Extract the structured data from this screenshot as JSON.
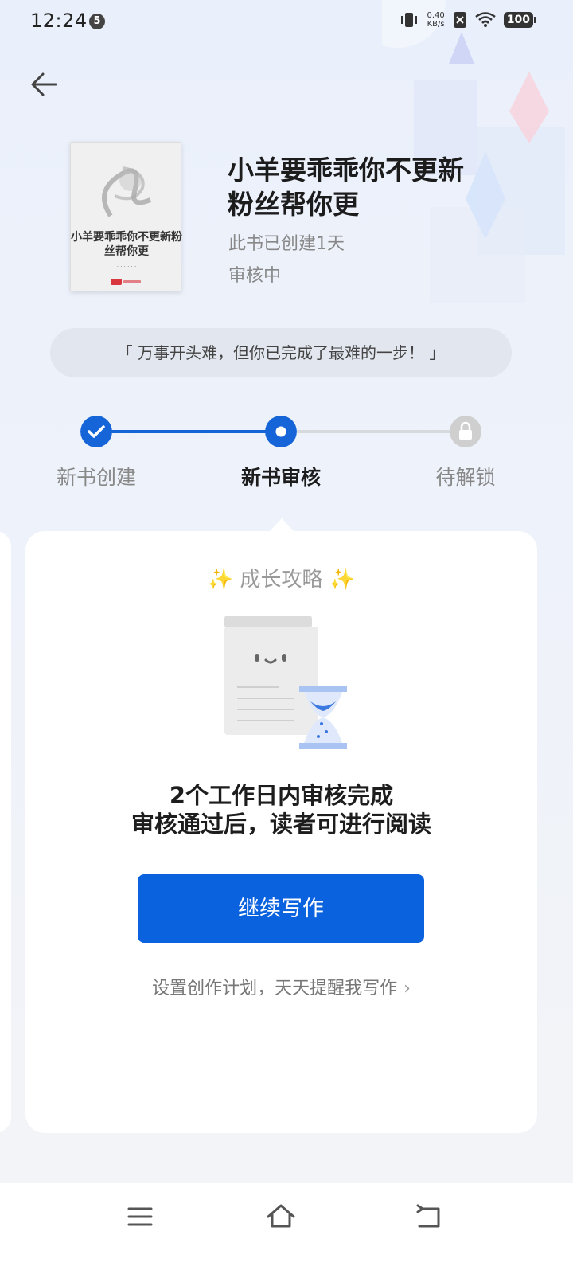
{
  "status_bar": {
    "time": "12:24",
    "notification_count": "5",
    "net_speed_value": "0.40",
    "net_speed_unit": "KB/s",
    "battery": "100"
  },
  "book": {
    "cover_title": "小羊要乖乖你不更新粉丝帮你更",
    "title": "小羊要乖乖你不更新粉丝帮你更",
    "created": "此书已创建1天",
    "status": "审核中"
  },
  "quote": "「 万事开头难，但你已完成了最难的一步！ 」",
  "progress": {
    "steps": [
      {
        "label": "新书创建",
        "state": "done"
      },
      {
        "label": "新书审核",
        "state": "current"
      },
      {
        "label": "待解锁",
        "state": "locked"
      }
    ],
    "colors": {
      "active": "#1565d8",
      "inactive": "#d6d9de",
      "lock": "#cfcfcf"
    }
  },
  "card": {
    "sparkle_left": "✨",
    "title": "成长攻略",
    "sparkle_right": "✨",
    "line1": "2个工作日内审核完成",
    "line2": "审核通过后，读者可进行阅读",
    "continue_button": "继续写作",
    "plan_link": "设置创作计划，天天提醒我写作",
    "plan_chevron": "›"
  },
  "nav": {
    "icons": [
      "menu-icon",
      "home-icon",
      "back-icon"
    ]
  },
  "colors": {
    "primary": "#0a62de"
  }
}
